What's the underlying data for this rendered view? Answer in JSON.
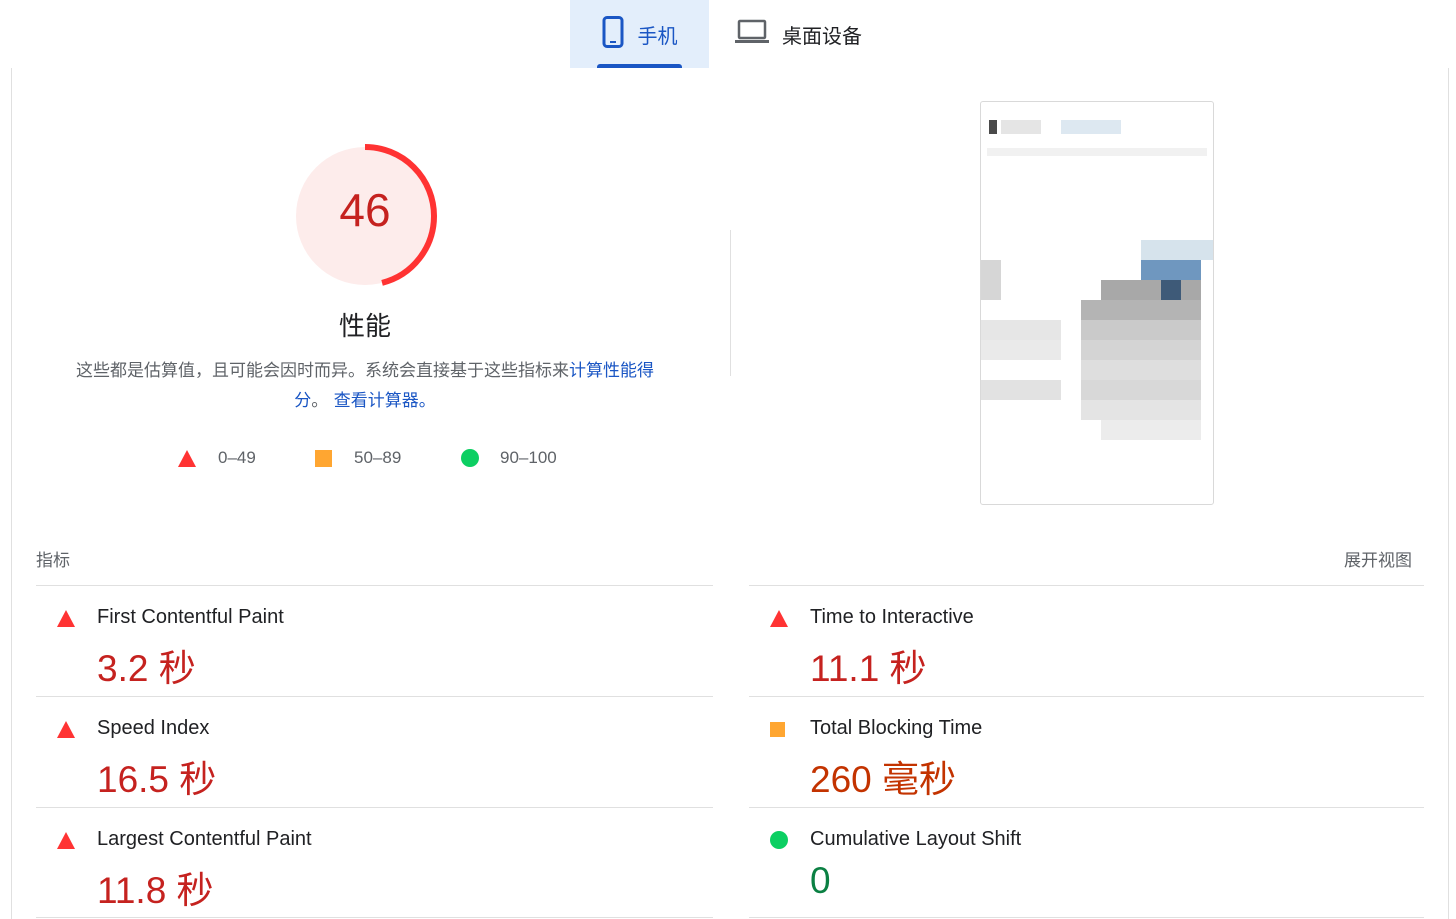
{
  "tabs": [
    {
      "label": "手机",
      "icon": "smartphone-icon",
      "active": true
    },
    {
      "label": "桌面设备",
      "icon": "laptop-icon",
      "active": false
    }
  ],
  "gauge": {
    "score": "46",
    "title": "性能",
    "fraction": 0.46,
    "color": "#ff3333"
  },
  "description": {
    "text": "这些都是估算值，且可能会因时而异。系统会直接基于这些指标来",
    "link1": "计算性能得分",
    "middle": "。",
    "link2": "查看计算器。"
  },
  "legend": [
    {
      "range": "0–49",
      "shape": "triangle",
      "color": "#ff3333"
    },
    {
      "range": "50–89",
      "shape": "square",
      "color": "#ffa631"
    },
    {
      "range": "90–100",
      "shape": "circle",
      "color": "#0ccf62"
    }
  ],
  "metrics_header": {
    "label": "指标",
    "expand": "展开视图"
  },
  "metrics": [
    {
      "name": "First Contentful Paint",
      "value": "3.2 秒",
      "status": "fail"
    },
    {
      "name": "Time to Interactive",
      "value": "11.1 秒",
      "status": "fail"
    },
    {
      "name": "Speed Index",
      "value": "16.5 秒",
      "status": "fail"
    },
    {
      "name": "Total Blocking Time",
      "value": "260 毫秒",
      "status": "average"
    },
    {
      "name": "Largest Contentful Paint",
      "value": "11.8 秒",
      "status": "fail"
    },
    {
      "name": "Cumulative Layout Shift",
      "value": "0",
      "status": "pass"
    }
  ]
}
